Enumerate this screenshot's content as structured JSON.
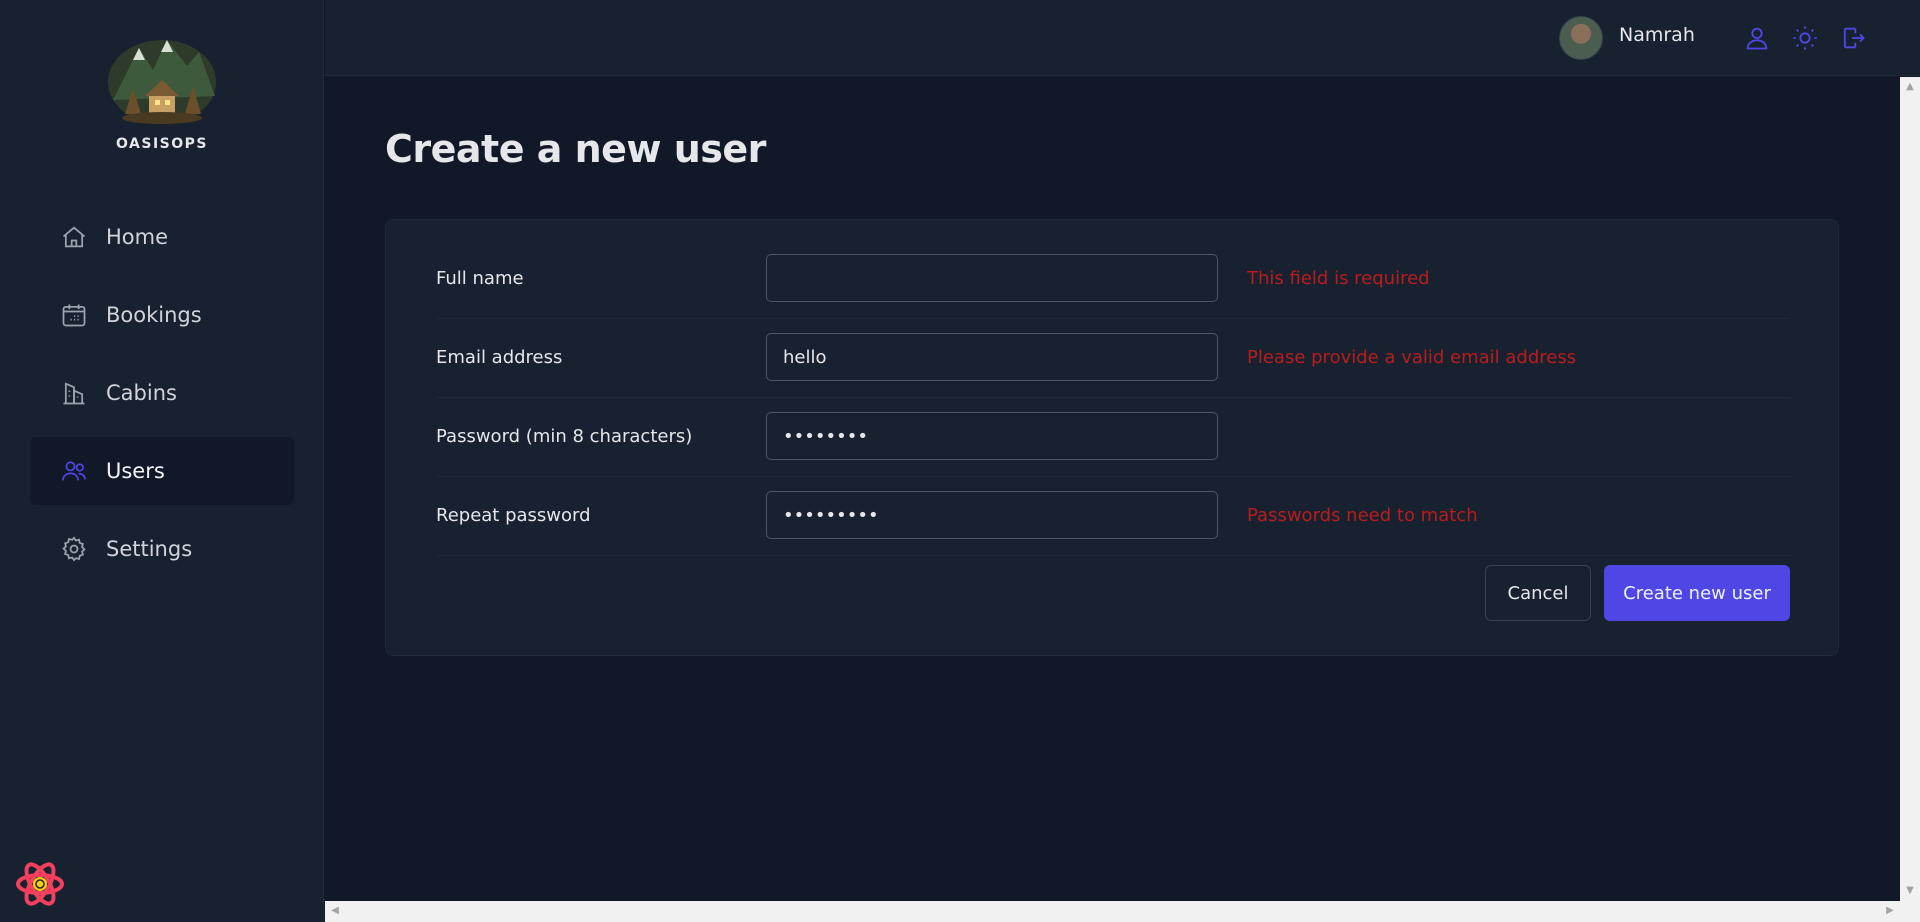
{
  "brand": {
    "name": "OASISOPS"
  },
  "sidebar": {
    "items": [
      {
        "label": "Home",
        "icon": "home-icon",
        "active": false
      },
      {
        "label": "Bookings",
        "icon": "calendar-icon",
        "active": false
      },
      {
        "label": "Cabins",
        "icon": "buildings-icon",
        "active": false
      },
      {
        "label": "Users",
        "icon": "users-icon",
        "active": true
      },
      {
        "label": "Settings",
        "icon": "gear-icon",
        "active": false
      }
    ]
  },
  "header": {
    "user_name": "Namrah",
    "icons": [
      "user-icon",
      "sun-icon",
      "logout-icon"
    ]
  },
  "page": {
    "title": "Create a new user"
  },
  "form": {
    "fields": [
      {
        "label": "Full name",
        "value": "",
        "type": "text",
        "error": "This field is required"
      },
      {
        "label": "Email address",
        "value": "hello",
        "type": "email",
        "error": "Please provide a valid email address"
      },
      {
        "label": "Password (min 8 characters)",
        "value": "12345678",
        "type": "password",
        "error": ""
      },
      {
        "label": "Repeat password",
        "value": "123456789",
        "type": "password",
        "error": "Passwords need to match"
      }
    ],
    "cancel_label": "Cancel",
    "submit_label": "Create new user"
  },
  "colors": {
    "accent": "#4f46e5",
    "error": "#b91c1c",
    "background": "#111827",
    "surface": "#18212f"
  }
}
